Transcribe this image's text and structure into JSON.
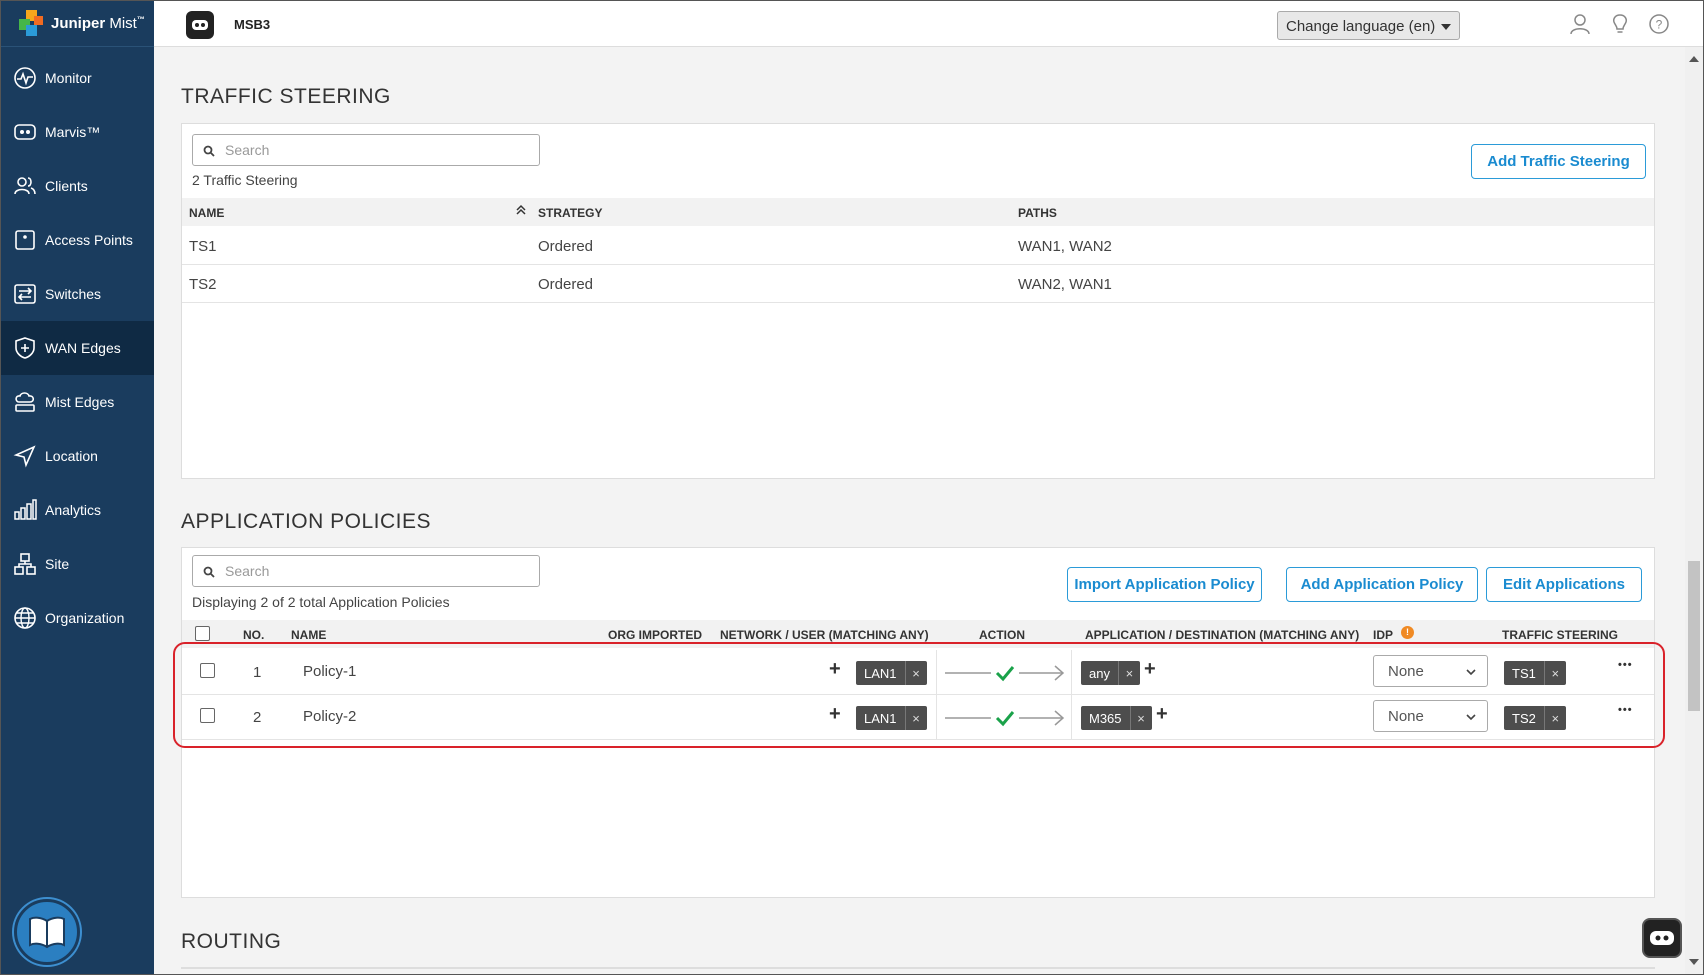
{
  "brand": {
    "name": "Juniper",
    "product": "Mist",
    "tm": "™"
  },
  "sidebar": {
    "items": [
      {
        "label": "Monitor",
        "icon": "monitor-icon"
      },
      {
        "label": "Marvis™",
        "icon": "marvis-icon"
      },
      {
        "label": "Clients",
        "icon": "clients-icon"
      },
      {
        "label": "Access Points",
        "icon": "access-point-icon"
      },
      {
        "label": "Switches",
        "icon": "switches-icon"
      },
      {
        "label": "WAN Edges",
        "icon": "wan-edges-icon",
        "active": true
      },
      {
        "label": "Mist Edges",
        "icon": "mist-edges-icon"
      },
      {
        "label": "Location",
        "icon": "location-icon"
      },
      {
        "label": "Analytics",
        "icon": "analytics-icon"
      },
      {
        "label": "Site",
        "icon": "site-icon"
      },
      {
        "label": "Organization",
        "icon": "organization-icon"
      }
    ]
  },
  "header": {
    "site_name": "MSB3",
    "language_label": "Change language (en)"
  },
  "traffic_steering": {
    "title": "TRAFFIC STEERING",
    "search_placeholder": "Search",
    "count_text": "2 Traffic Steering",
    "add_button": "Add Traffic Steering",
    "columns": {
      "name": "NAME",
      "strategy": "STRATEGY",
      "paths": "PATHS"
    },
    "rows": [
      {
        "name": "TS1",
        "strategy": "Ordered",
        "paths": "WAN1, WAN2"
      },
      {
        "name": "TS2",
        "strategy": "Ordered",
        "paths": "WAN2, WAN1"
      }
    ]
  },
  "application_policies": {
    "title": "APPLICATION POLICIES",
    "search_placeholder": "Search",
    "count_text": "Displaying 2 of 2 total Application Policies",
    "buttons": {
      "import": "Import Application Policy",
      "add": "Add Application Policy",
      "edit": "Edit Applications"
    },
    "columns": {
      "no": "NO.",
      "name": "NAME",
      "org_imported": "ORG IMPORTED",
      "network": "NETWORK / USER (MATCHING ANY)",
      "action": "ACTION",
      "application": "APPLICATION / DESTINATION (MATCHING ANY)",
      "idp": "IDP",
      "idp_badge": "!",
      "traffic_steering": "TRAFFIC STEERING"
    },
    "rows": [
      {
        "no": "1",
        "name": "Policy-1",
        "network": "LAN1",
        "action": "allow",
        "application": "any",
        "idp": "None",
        "traffic_steering": "TS1"
      },
      {
        "no": "2",
        "name": "Policy-2",
        "network": "LAN1",
        "action": "allow",
        "application": "M365",
        "idp": "None",
        "traffic_steering": "TS2"
      }
    ],
    "tag_remove": "×",
    "more": "•••"
  },
  "routing": {
    "title": "ROUTING"
  },
  "colors": {
    "sidebar_bg": "#1a3c5e",
    "sidebar_active": "#0f2a44",
    "accent": "#1a8bd0",
    "highlight": "#d9222a",
    "allow_check": "#1aa24a"
  }
}
